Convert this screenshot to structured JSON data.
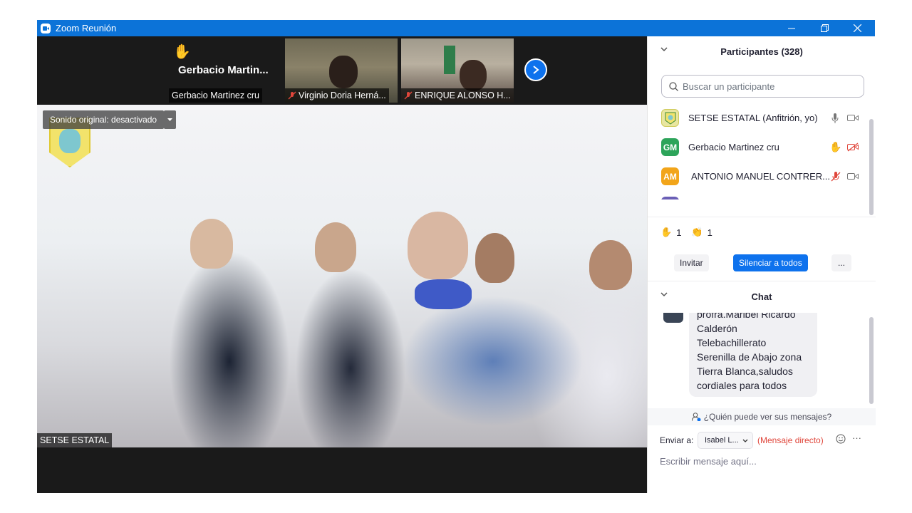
{
  "window": {
    "title": "Zoom Reunión",
    "accent_color": "#0c73d8"
  },
  "video_strip": {
    "tiles": [
      {
        "big_name": "Gerbacio  Martin...",
        "label": "Gerbacio Martinez cru"
      },
      {
        "label": "Virginio Doria Herná..."
      },
      {
        "label": "ENRIQUE ALONSO H..."
      }
    ]
  },
  "main_video": {
    "original_sound": "Sonido original: desactivado",
    "speaker_label": "SETSE ESTATAL"
  },
  "participants": {
    "header": "Participantes (328)",
    "search_placeholder": "Buscar un participante",
    "list": [
      {
        "initials": "",
        "name": "SETSE ESTATAL (Anfitrión, yo)",
        "avatar_color": "#e8e6a0"
      },
      {
        "initials": "GM",
        "name": "Gerbacio Martinez cru",
        "avatar_color": "#2da45a"
      },
      {
        "initials": "AM",
        "name": "ANTONIO MANUEL CONTRER...",
        "avatar_color": "#f2a51a"
      }
    ],
    "reactions": [
      {
        "icon": "raised-hand",
        "count": "1"
      },
      {
        "icon": "clapping-hands",
        "count": "1"
      }
    ],
    "invite_label": "Invitar",
    "mute_all_label": "Silenciar a todos",
    "more_label": "..."
  },
  "chat": {
    "header": "Chat",
    "message_lines": [
      "profra.Maribel Ricardo",
      "Calderón",
      "Telebachillerato",
      "Serenilla de Abajo zona",
      "Tierra Blanca,saludos",
      "cordiales para todos"
    ],
    "who_can_see": "¿Quién puede ver sus mensajes?",
    "send_to_label": "Enviar a:",
    "recipient": "Isabel L...",
    "direct_label": "(Mensaje directo)",
    "input_placeholder": "Escribir mensaje aquí..."
  }
}
